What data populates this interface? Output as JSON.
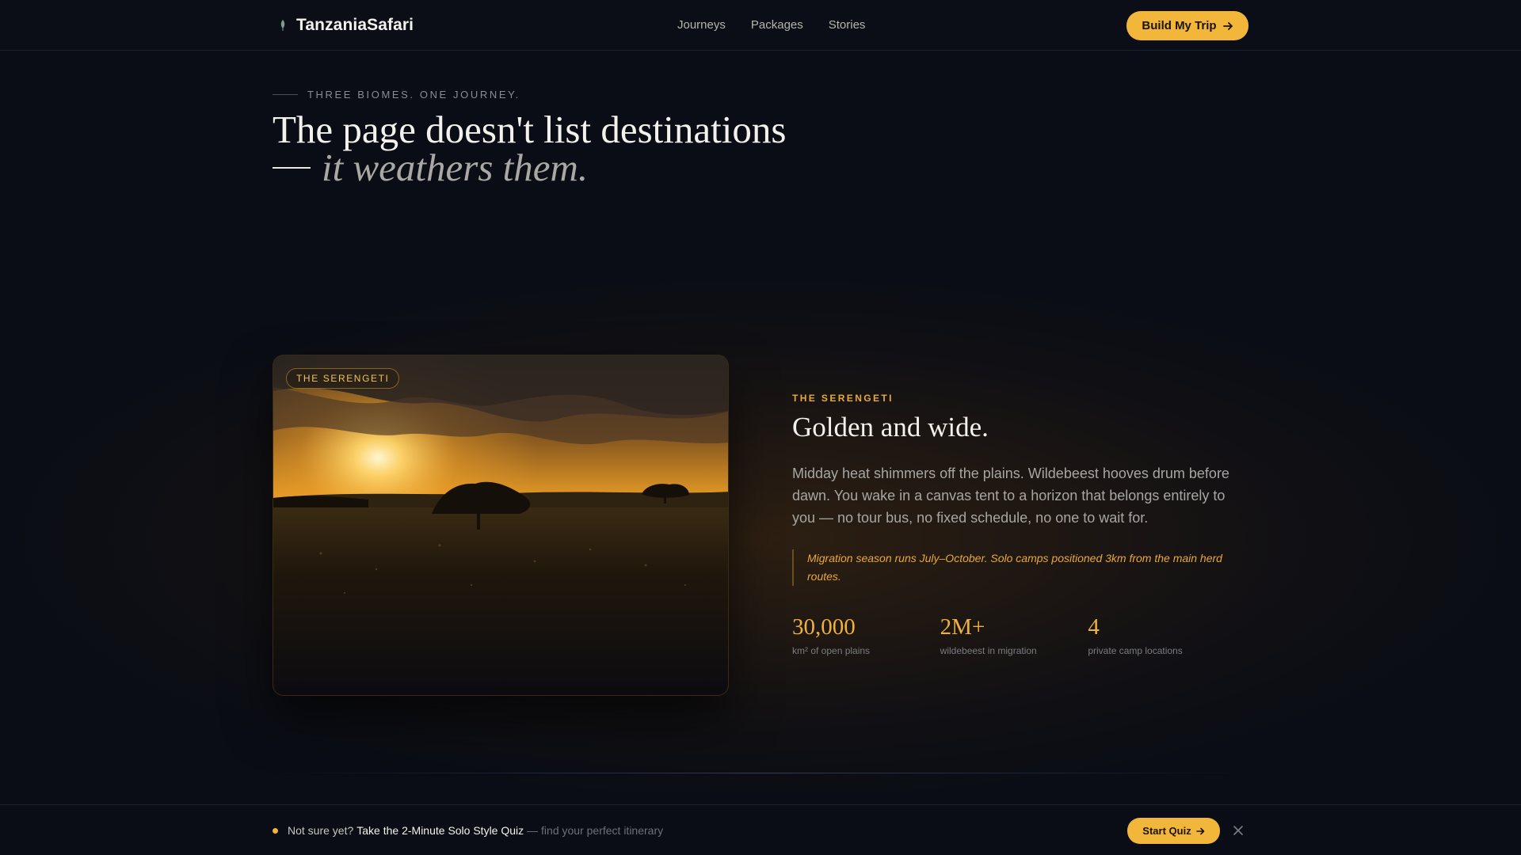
{
  "brand": {
    "name": "TanzaniaSafari",
    "icon": "acacia-leaf-icon"
  },
  "nav": {
    "items": [
      "Journeys",
      "Packages",
      "Stories"
    ]
  },
  "header_cta": {
    "label": "Build My Trip",
    "icon": "arrow-right-icon"
  },
  "hero": {
    "eyebrow": "THREE BIOMES. ONE JOURNEY.",
    "title_line1": "The page doesn't list destinations",
    "title_line2": "it weathers them."
  },
  "biome": {
    "badge": "THE SERENGETI",
    "kicker": "THE SERENGETI",
    "title": "Golden and wide.",
    "body": "Midday heat shimmers off the plains. Wildebeest hooves drum before dawn. You wake in a canvas tent to a horizon that belongs entirely to you — no tour bus, no fixed schedule, no one to wait for.",
    "note": "Migration season runs July–October. Solo camps positioned 3km from the main herd routes.",
    "stats": [
      {
        "value": "30,000",
        "label": "km² of open plains"
      },
      {
        "value": "2M+",
        "label": "wildebeest in migration"
      },
      {
        "value": "4",
        "label": "private camp locations"
      }
    ]
  },
  "quiz_bar": {
    "lead": "Not sure yet?",
    "link": "Take the 2-Minute Solo Style Quiz",
    "tail": "— find your perfect itinerary",
    "button": "Start Quiz",
    "close_icon": "close-icon"
  },
  "colors": {
    "accent": "#f2b63b",
    "background": "#0a0d15",
    "text": "#f3f1ec"
  }
}
